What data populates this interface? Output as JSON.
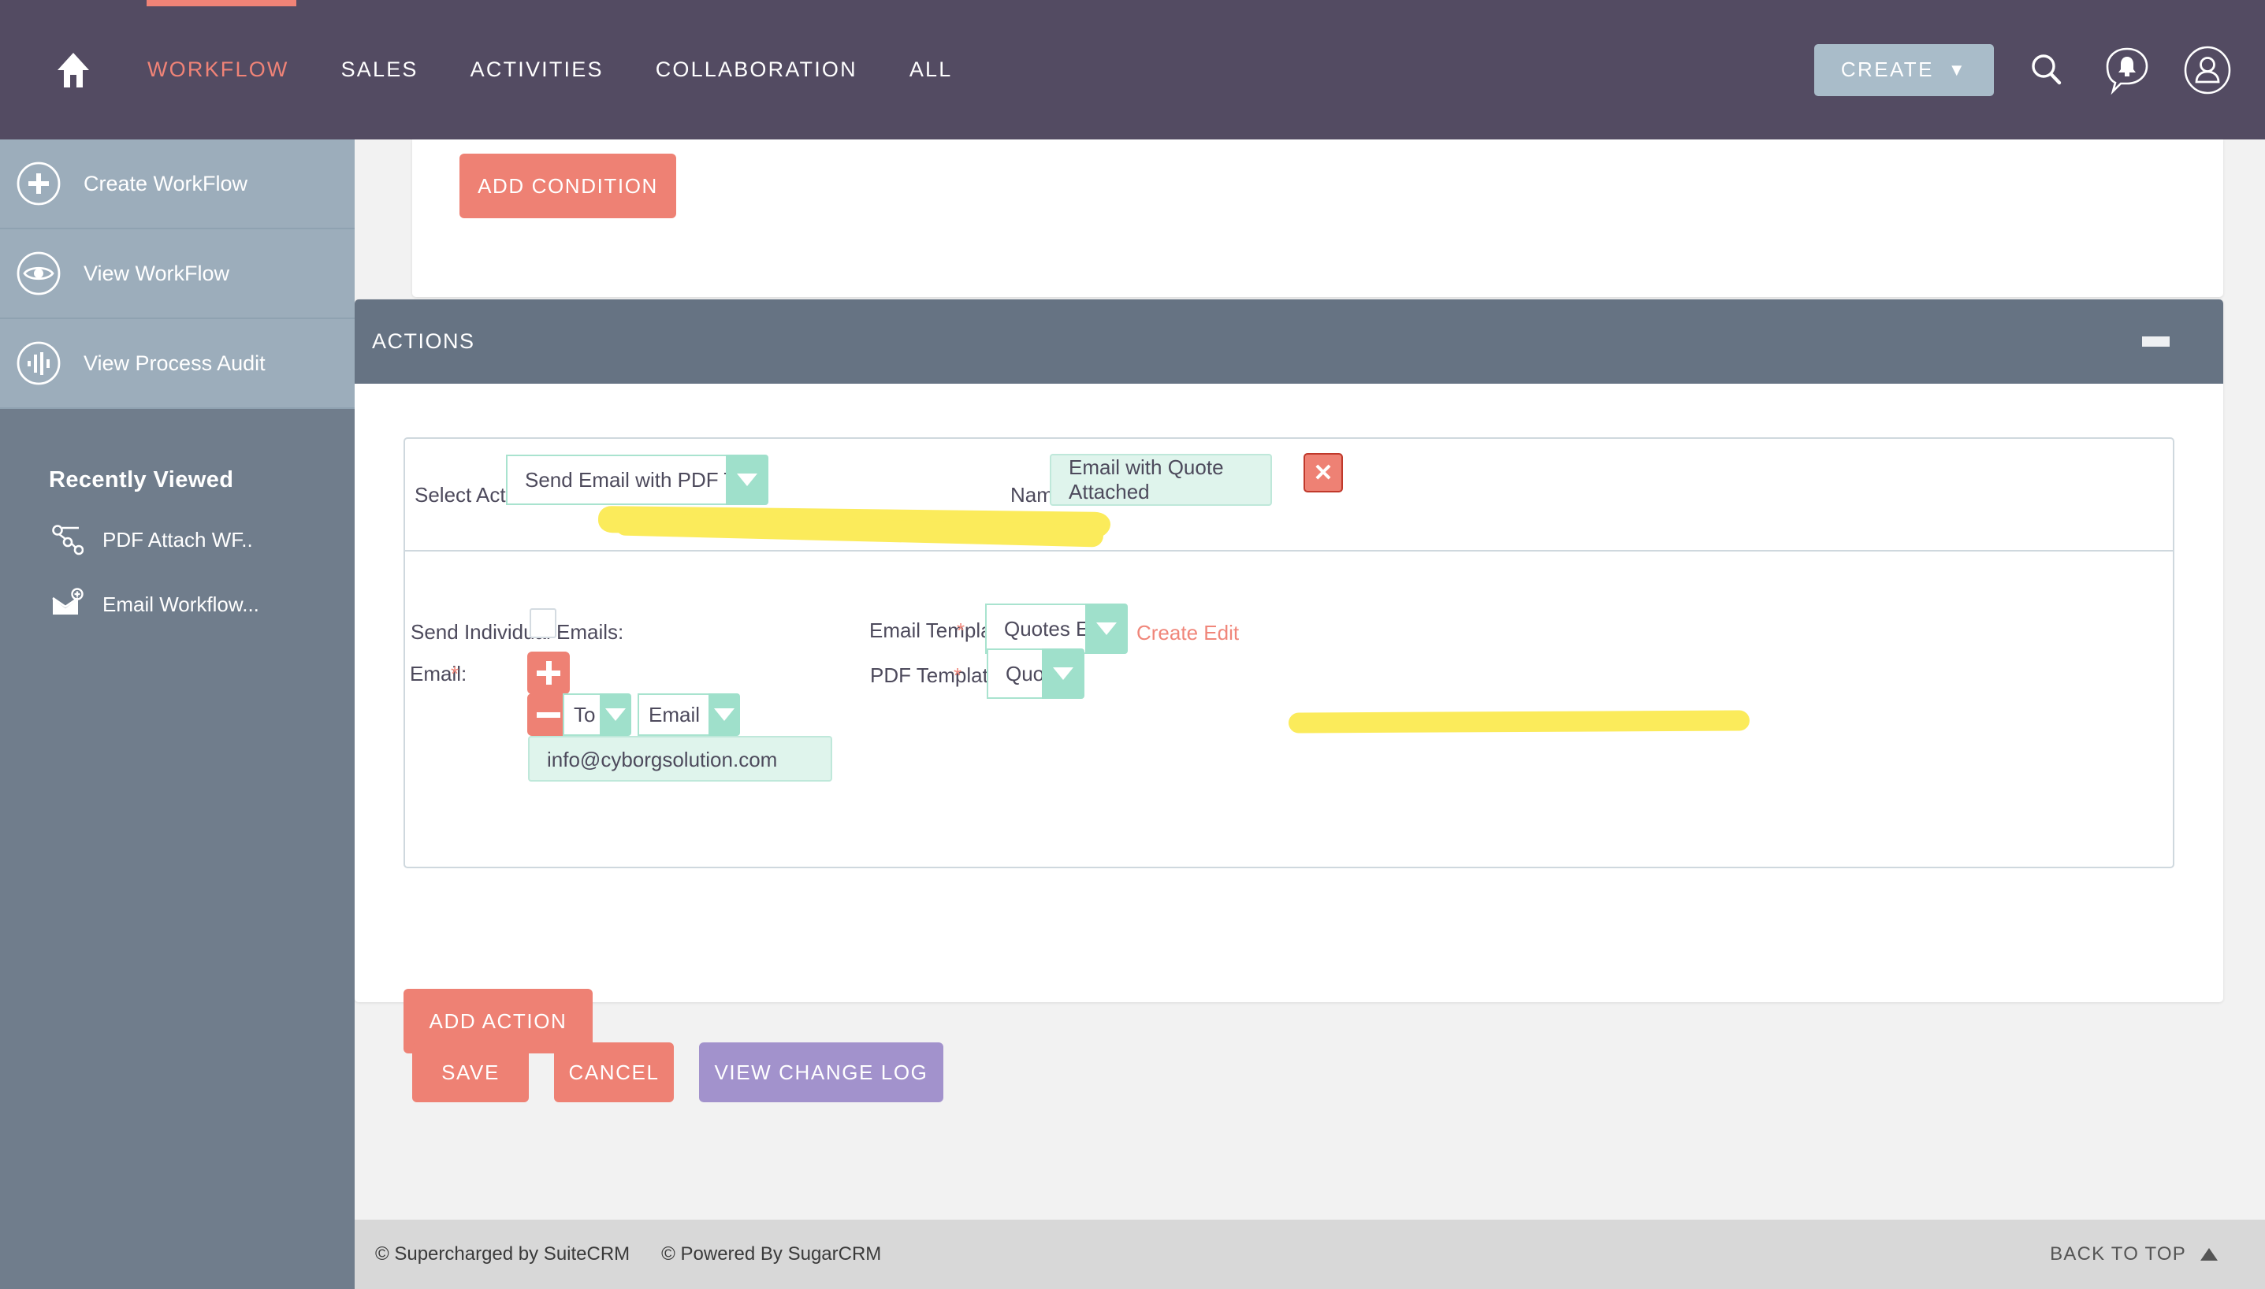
{
  "nav": {
    "home_icon": "home-icon",
    "items": [
      {
        "label": "WORKFLOW",
        "active": true
      },
      {
        "label": "SALES",
        "active": false
      },
      {
        "label": "ACTIVITIES",
        "active": false
      },
      {
        "label": "COLLABORATION",
        "active": false
      },
      {
        "label": "ALL",
        "active": false
      }
    ],
    "create_label": "CREATE",
    "create_caret": "▼",
    "search_icon": "search-icon",
    "notifications_icon": "notification-bell-icon",
    "profile_icon": "user-profile-icon"
  },
  "sidebar": {
    "items": [
      {
        "label": "Create WorkFlow",
        "icon": "plus-circle-icon"
      },
      {
        "label": "View WorkFlow",
        "icon": "eye-icon"
      },
      {
        "label": "View Process Audit",
        "icon": "audit-waveform-icon"
      }
    ],
    "recently_viewed_title": "Recently Viewed",
    "recent_items": [
      {
        "label": "PDF Attach WF..",
        "icon": "workflow-node-icon"
      },
      {
        "label": "Email Workflow...",
        "icon": "email-plus-icon"
      }
    ],
    "collapse_icon": "collapse-left-icon"
  },
  "main": {
    "add_condition_label": "ADD CONDITION",
    "actions_panel": {
      "title": "ACTIONS",
      "collapse_icon": "minus-collapse-icon",
      "add_action_label": "ADD ACTION",
      "action": {
        "select_action_label": "Select Action:",
        "select_action_value": "Send Email with PDF Template Attachment",
        "name_label": "Name:",
        "name_value": "Email with Quote Attached",
        "remove_icon": "close-x-icon",
        "send_individual_label": "Send Individual Emails:",
        "send_individual_checked": false,
        "email_label": "Email:",
        "email_required": "*",
        "add_recipient_icon": "plus-icon",
        "remove_recipient_icon": "minus-icon",
        "recipient_type_value": "To",
        "recipient_field_value": "Email",
        "recipient_address": "info@cyborgsolution.com",
        "email_template_label": "Email Template:",
        "email_template_required": "*",
        "email_template_value": "Quotes Estimate",
        "email_template_link": "Create Edit",
        "pdf_template_label": "PDF Template:",
        "pdf_template_required": "*",
        "pdf_template_value": "Quote Details PDF"
      }
    },
    "buttons": {
      "save": "SAVE",
      "cancel": "CANCEL",
      "view_change_log": "VIEW CHANGE LOG"
    }
  },
  "footer": {
    "supercharged": "© Supercharged by SuiteCRM",
    "powered": "© Powered By SugarCRM",
    "back_to_top": "BACK TO TOP"
  },
  "colors": {
    "nav_bg": "#534b62",
    "accent_coral": "#ee8174",
    "sidebar_bg": "#707d8c",
    "sidebar_item_bg": "#9cadbb",
    "panel_header": "#667383",
    "mint": "#9fe0cb",
    "mint_fill": "#dff4ec",
    "purple": "#a292cc",
    "highlighter": "#fbeb5b"
  }
}
